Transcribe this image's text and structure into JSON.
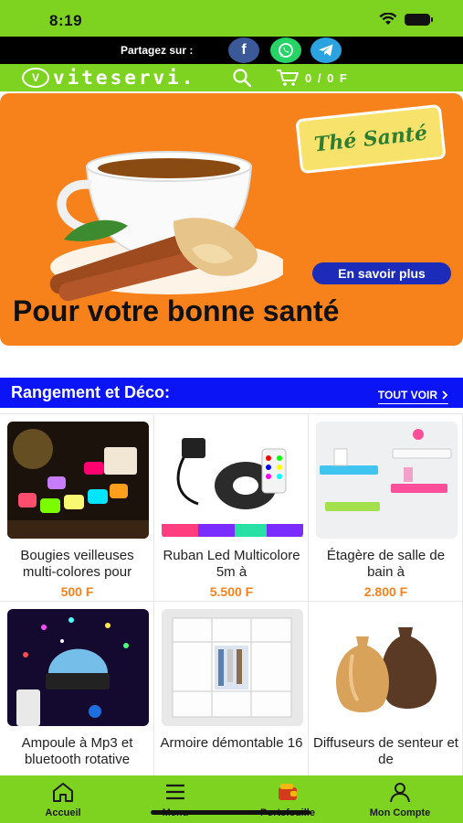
{
  "status_bar": {
    "time": "8:19"
  },
  "share_bar": {
    "label": "Partagez sur :",
    "buttons": [
      {
        "icon": "facebook-icon",
        "glyph": "f"
      },
      {
        "icon": "whatsapp-icon"
      },
      {
        "icon": "telegram-icon"
      }
    ]
  },
  "header": {
    "logo_text": "viteservi.",
    "cart_total": "0 / 0 F"
  },
  "banner": {
    "brand": "Thé Santé",
    "cta": "En savoir plus",
    "title": "Pour votre bonne santé"
  },
  "section": {
    "title": "Rangement et Déco:",
    "more": "TOUT VOIR"
  },
  "products": [
    {
      "name": "Bougies veilleuses multi-colores pour",
      "price": "500 F"
    },
    {
      "name": "Ruban Led Multicolore 5m à",
      "price": "5.500 F"
    },
    {
      "name": "Étagère de salle de bain à",
      "price": "2.800 F"
    },
    {
      "name": "Ampoule à Mp3 et bluetooth rotative",
      "price": ""
    },
    {
      "name": "Armoire démontable 16",
      "price": ""
    },
    {
      "name": "Diffuseurs de senteur et de",
      "price": ""
    }
  ],
  "tabbar": {
    "items": [
      {
        "label": "Accueil",
        "icon": "home-icon"
      },
      {
        "label": "Menu",
        "icon": "menu-icon"
      },
      {
        "label": "Portefeuille",
        "icon": "wallet-icon"
      },
      {
        "label": "Mon Compte",
        "icon": "user-icon"
      }
    ]
  },
  "colors": {
    "brand_green": "#7ed321",
    "banner_orange": "#f7821b",
    "section_blue": "#0a14f5",
    "price_orange": "#f7821b"
  }
}
